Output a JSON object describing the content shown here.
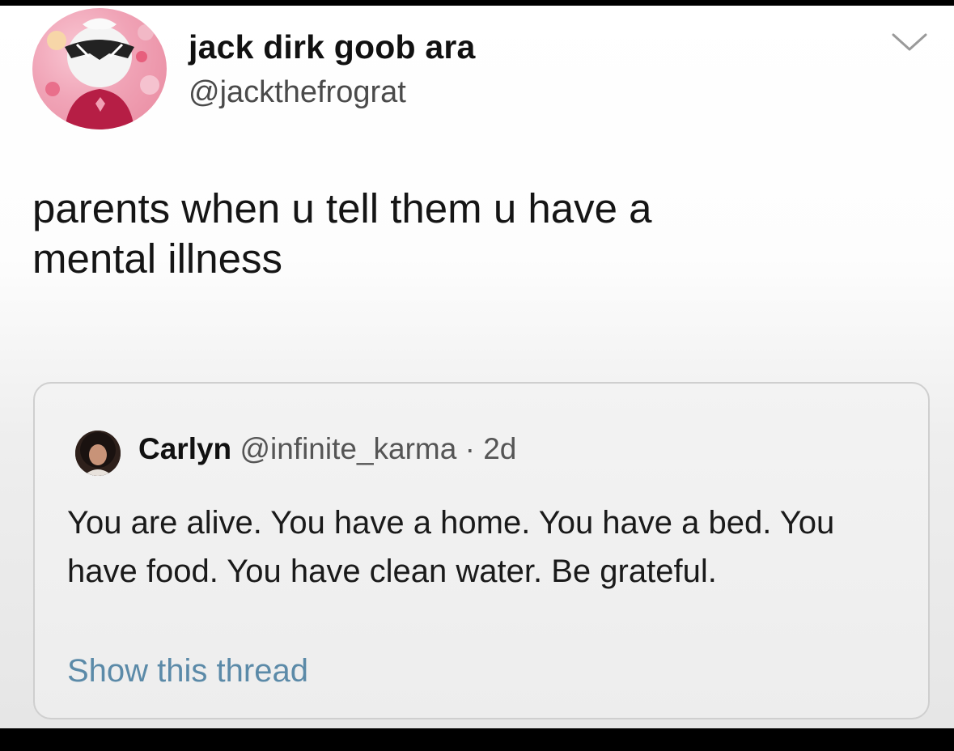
{
  "author": {
    "display_name": "jack dirk goob ara",
    "handle": "@jackthefrograt",
    "avatar_icon": "cartoon-character-avatar"
  },
  "menu_icon": "chevron-down-icon",
  "tweet": {
    "text": "parents when u tell them u have a\nmental illness"
  },
  "quoted_tweet": {
    "author_name": "Carlyn",
    "author_handle": "@infinite_karma",
    "separator": "·",
    "timestamp": "2d",
    "text": "You are alive. You have a home. You have a bed. You have food. You have clean water. Be grateful.",
    "show_thread_label": "Show this thread",
    "avatar_icon": "profile-photo-avatar"
  },
  "colors": {
    "link": "#5b8aa8",
    "name": "#111111",
    "secondary_text": "#555555",
    "border": "#cfcfcf"
  }
}
